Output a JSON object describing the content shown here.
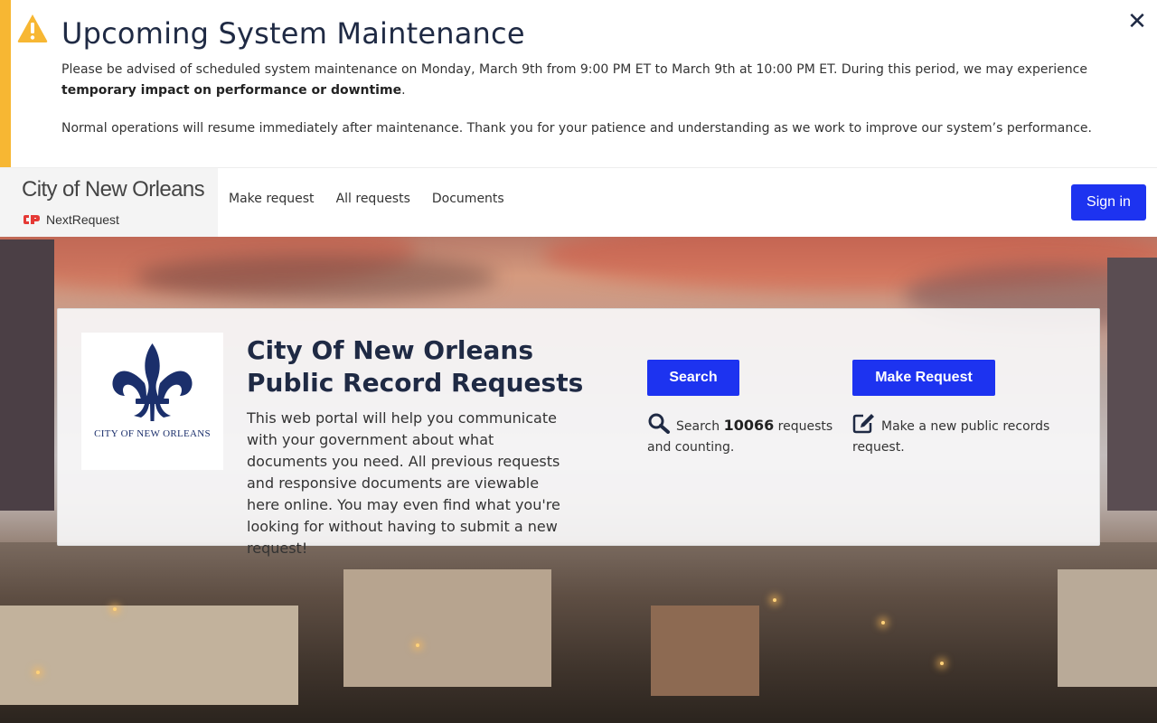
{
  "banner": {
    "icon": "warning-icon",
    "title": "Upcoming System Maintenance",
    "p1_text": "Please be advised of scheduled system maintenance on Monday, March 9th from 9:00 PM ET to March 9th at 10:00 PM ET. During this period, we may experience ",
    "p1_bold": "temporary impact on performance or downtime",
    "p1_end": ".",
    "p2": "Normal operations will resume immediately after maintenance. Thank you for your patience and understanding as we work to improve our system’s performance.",
    "close_icon": "close-icon",
    "accent_color": "#f7b733"
  },
  "navbar": {
    "brand_name": "City of New Orleans",
    "brand_sub": "NextRequest",
    "links": [
      "Make request",
      "All requests",
      "Documents"
    ],
    "signin_label": "Sign in",
    "accent_color": "#1d33f0"
  },
  "card": {
    "seal_label": "CITY OF NEW ORLEANS",
    "title": "City Of New Orleans Public Record Requests",
    "description": "This web portal will help you communicate with your government about what documents you need. All previous requests and responsive documents are viewable here online. You may even find what you're looking for without having to submit a new request!",
    "search": {
      "button": "Search",
      "text_before": "Search ",
      "count": "10066",
      "text_after": " requests and counting.",
      "icon": "magnifier-icon"
    },
    "make": {
      "button": "Make Request",
      "text": "Make a new public records request.",
      "icon": "edit-icon"
    }
  }
}
